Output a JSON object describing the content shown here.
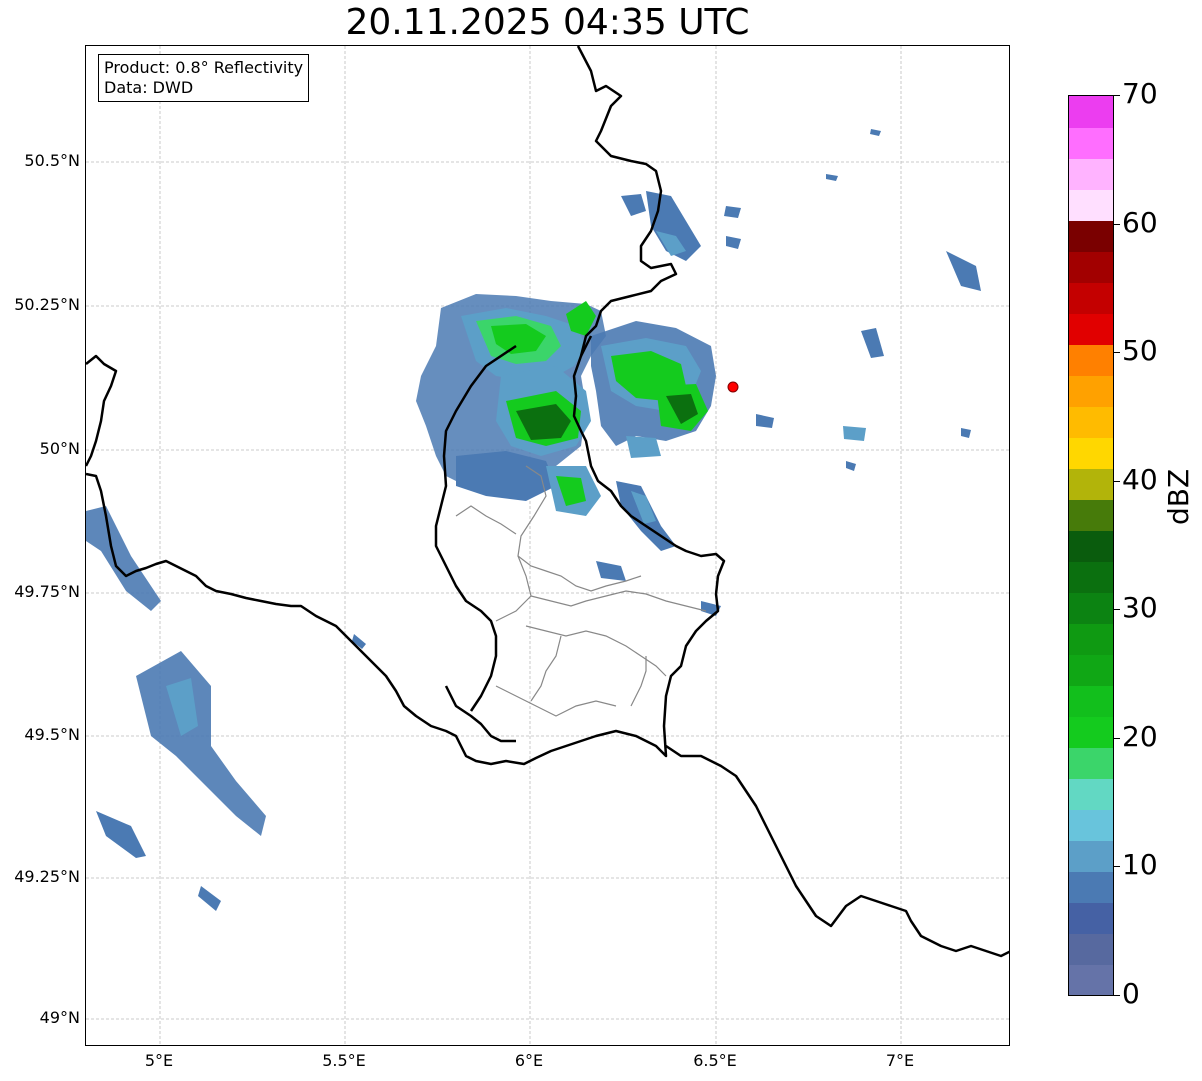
{
  "title": "20.11.2025 04:35 UTC",
  "info": {
    "product": "Product: 0.8° Reflectivity",
    "data": "Data: DWD"
  },
  "axes": {
    "lat_ticks": [
      "50.5°N",
      "50.25°N",
      "50°N",
      "49.75°N",
      "49.5°N",
      "49.25°N",
      "49°N"
    ],
    "lon_ticks": [
      "5°E",
      "5.5°E",
      "6°E",
      "6.5°E",
      "7°E"
    ]
  },
  "colorbar": {
    "label": "dBZ",
    "ticks": [
      "0",
      "10",
      "20",
      "30",
      "40",
      "50",
      "60",
      "70"
    ],
    "colors": [
      "#6573a8",
      "#57699f",
      "#4561a4",
      "#4b7ab3",
      "#5c9fc8",
      "#68c4dc",
      "#62d8c3",
      "#3bd56a",
      "#14cb1e",
      "#12bf1c",
      "#10a715",
      "#0f9a12",
      "#0c8312",
      "#0b700f",
      "#0a5c0d",
      "#477b0a",
      "#b2b40a",
      "#ffd700",
      "#ffbb00",
      "#ffa100",
      "#ff8000",
      "#e10000",
      "#c40000",
      "#a20000",
      "#7a0000",
      "#ffdfff",
      "#ffb3ff",
      "#ff6eff",
      "#ec3df0"
    ]
  },
  "marker": {
    "color": "#ff0000"
  }
}
